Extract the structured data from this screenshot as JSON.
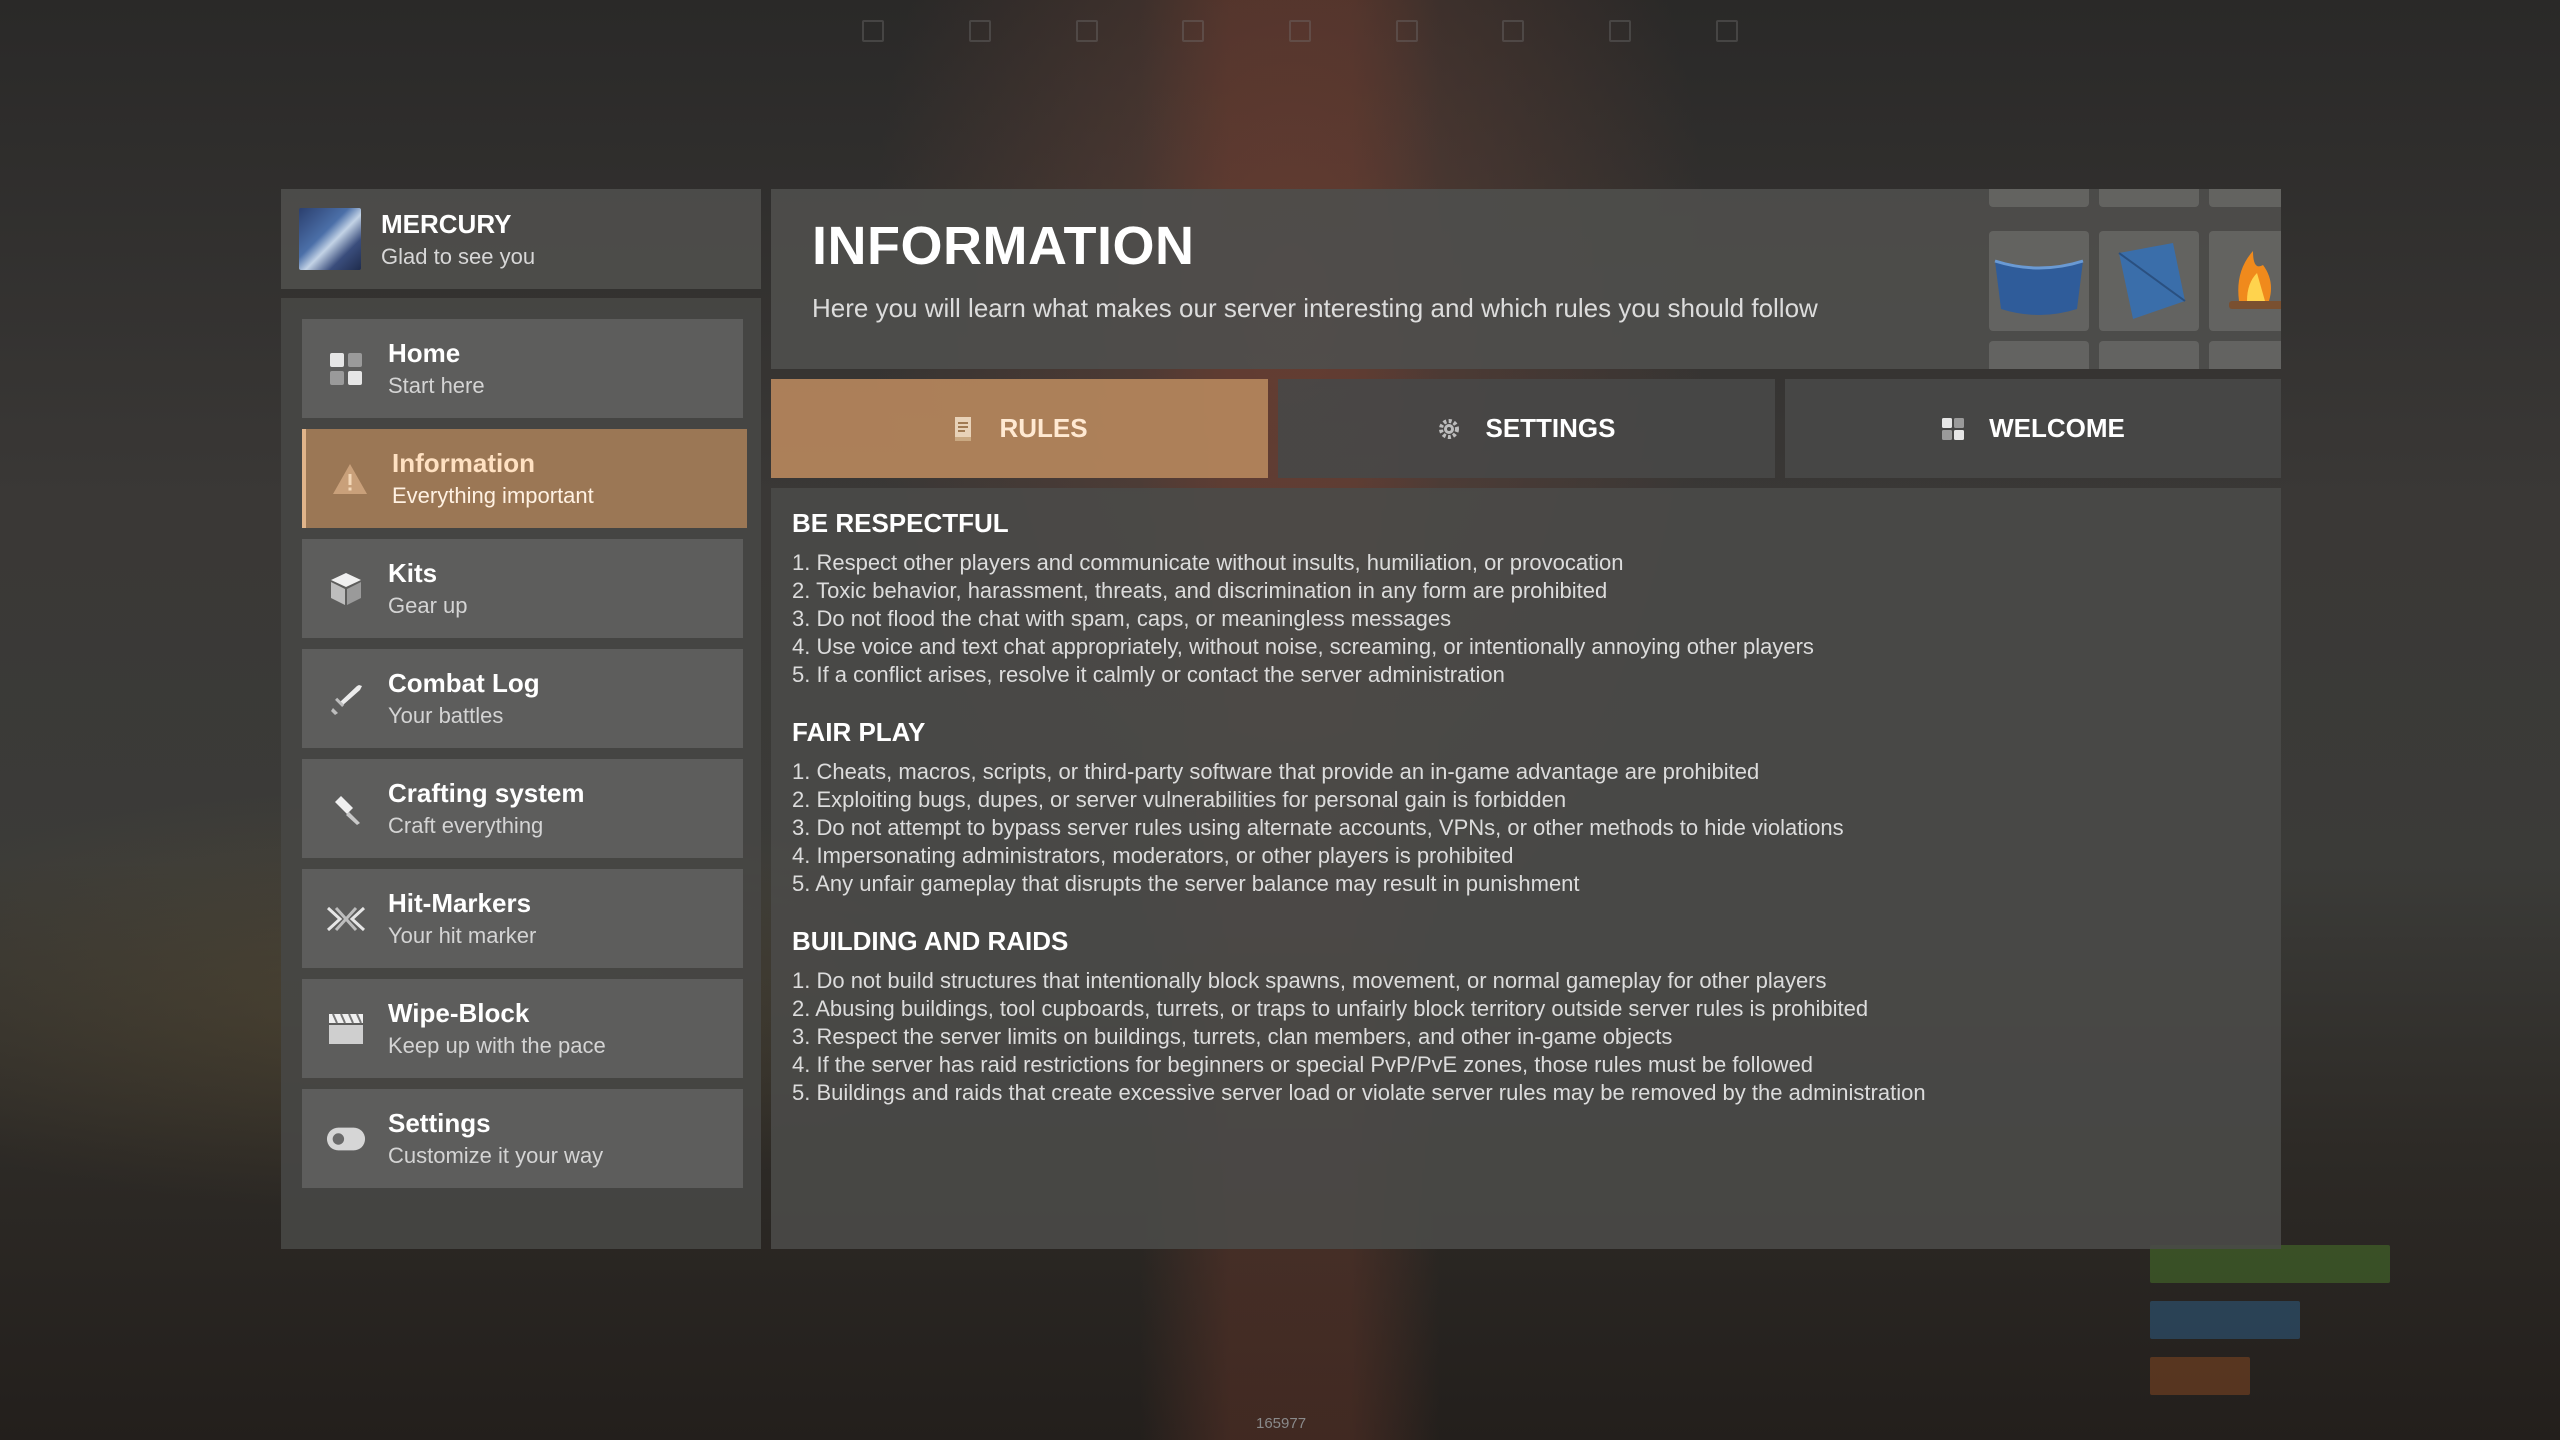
{
  "profile": {
    "name": "MERCURY",
    "greeting": "Glad to see you"
  },
  "sidebar": {
    "items": [
      {
        "label": "Home",
        "sub": "Start here",
        "icon": "grid-icon",
        "active": false
      },
      {
        "label": "Information",
        "sub": "Everything important",
        "icon": "warning-icon",
        "active": true
      },
      {
        "label": "Kits",
        "sub": "Gear up",
        "icon": "box-icon",
        "active": false
      },
      {
        "label": "Combat Log",
        "sub": "Your battles",
        "icon": "sword-icon",
        "active": false
      },
      {
        "label": "Crafting system",
        "sub": "Craft everything",
        "icon": "hammer-icon",
        "active": false
      },
      {
        "label": "Hit-Markers",
        "sub": "Your hit marker",
        "icon": "crossed-swords-icon",
        "active": false
      },
      {
        "label": "Wipe-Block",
        "sub": "Keep up with the pace",
        "icon": "clapperboard-icon",
        "active": false
      },
      {
        "label": "Settings",
        "sub": "Customize it your way",
        "icon": "toggle-icon",
        "active": false
      }
    ]
  },
  "header": {
    "title": "INFORMATION",
    "description": "Here you will learn what makes our server interesting and which rules you should follow"
  },
  "tabs": [
    {
      "label": "RULES",
      "icon": "book-icon",
      "active": true
    },
    {
      "label": "SETTINGS",
      "icon": "gear-icon",
      "active": false
    },
    {
      "label": "WELCOME",
      "icon": "grid-icon",
      "active": false
    }
  ],
  "sections": [
    {
      "title": "BE RESPECTFUL",
      "lines": [
        "1. Respect other players and communicate without insults, humiliation, or provocation",
        "2. Toxic behavior, harassment, threats, and discrimination in any form are prohibited",
        "3. Do not flood the chat with spam, caps, or meaningless messages",
        "4. Use voice and text chat appropriately, without noise, screaming, or intentionally annoying other players",
        "5. If a conflict arises, resolve it calmly or contact the server administration"
      ]
    },
    {
      "title": "FAIR PLAY",
      "lines": [
        "1. Cheats, macros, scripts, or third-party software that provide an in-game advantage are prohibited",
        "2. Exploiting bugs, dupes, or server vulnerabilities for personal gain is forbidden",
        "3. Do not attempt to bypass server rules using alternate accounts, VPNs, or other methods to hide violations",
        "4. Impersonating administrators, moderators, or other players is prohibited",
        "5. Any unfair gameplay that disrupts the server balance may result in punishment"
      ]
    },
    {
      "title": "BUILDING AND RAIDS",
      "lines": [
        "1. Do not build structures that intentionally block spawns, movement, or normal gameplay for other players",
        "2. Abusing buildings, tool cupboards, turrets, or traps to unfairly block territory outside server rules is prohibited",
        "3. Respect the server limits on buildings, turrets, clan members, and other in-game objects",
        "4. If the server has raid restrictions for beginners or special PvP/PvE zones, those rules must be followed",
        "5. Buildings and raids that create excessive server load or violate server rules may be removed by the administration"
      ]
    }
  ],
  "hud": {
    "id": "165977"
  },
  "colors": {
    "accent": "#b2845c",
    "accent_light": "#e0b48a",
    "panel": "#4e4e4c"
  }
}
